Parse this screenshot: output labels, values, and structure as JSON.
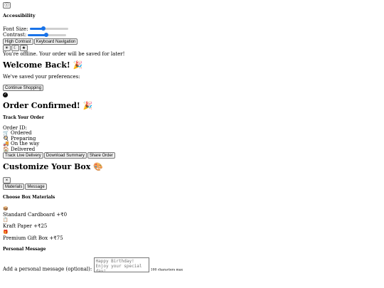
{
  "top": {
    "info_icon": "ⓘ"
  },
  "accessibility": {
    "title": "Accessibility",
    "font_size_label": "Font Size:",
    "font_size_value": 0.35,
    "contrast_label": "Contrast:",
    "contrast_value": 0.48,
    "high_contrast": "High Contrast",
    "keyboard_nav": "Keyboard Navigation",
    "theme_icons": [
      "☀",
      "☾",
      "★"
    ],
    "accent": "#1a73e8"
  },
  "offline": {
    "message": "You're offline. Your order will be saved for later!"
  },
  "welcome": {
    "title": "Welcome Back! 🎉",
    "text": "We've saved your preferences:",
    "continue": "Continue Shopping",
    "check": "✓"
  },
  "order": {
    "title": "Order Confirmed! 🎉",
    "track_heading": "Track Your Order",
    "order_id_label": "Order ID:",
    "statuses": [
      {
        "icon": "🛒",
        "label": "Ordered"
      },
      {
        "icon": "🍳",
        "label": "Preparing"
      },
      {
        "icon": "🚚",
        "label": "On the way"
      },
      {
        "icon": "🏠",
        "label": "Delivered"
      }
    ],
    "buttons": [
      "Track Live Delivery",
      "Download Summary",
      "Share Order"
    ]
  },
  "customize": {
    "title": "Customize Your Box 🎨",
    "nav_button": "×",
    "tabs": [
      "Materials",
      "Message"
    ],
    "materials_heading": "Choose Box Materials",
    "materials": [
      {
        "icon": "📦",
        "label": "Standard Cardboard +₹0"
      },
      {
        "icon": "📋",
        "label": "Kraft Paper +₹25"
      },
      {
        "icon": "🎁",
        "label": "Premium Gift Box +₹75"
      }
    ],
    "message_heading": "Personal Message",
    "message_label": "Add a personal message (optional):",
    "message_placeholder": "Happy Birthday! Enjoy your special day!",
    "char_limit": "100 characters max"
  }
}
